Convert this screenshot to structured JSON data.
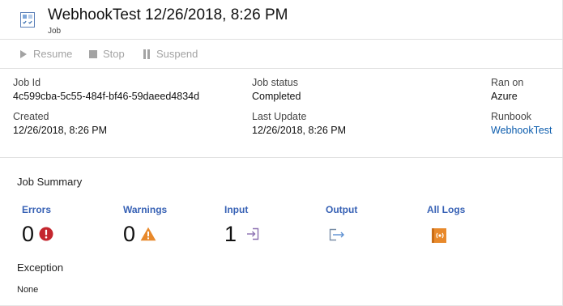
{
  "header": {
    "title": "WebhookTest 12/26/2018, 8:26 PM",
    "subtitle": "Job",
    "icon": "job-icon"
  },
  "toolbar": {
    "resume_label": "Resume",
    "stop_label": "Stop",
    "suspend_label": "Suspend",
    "disabled_color": "#a3a3a3"
  },
  "details": {
    "job_id_label": "Job Id",
    "job_id_value": "4c599cba-5c55-484f-bf46-59daeed4834d",
    "created_label": "Created",
    "created_value": "12/26/2018, 8:26 PM",
    "job_status_label": "Job status",
    "job_status_value": "Completed",
    "last_update_label": "Last Update",
    "last_update_value": "12/26/2018, 8:26 PM",
    "ran_on_label": "Ran on",
    "ran_on_value": "Azure",
    "runbook_label": "Runbook",
    "runbook_value": "WebhookTest"
  },
  "summary": {
    "title": "Job Summary",
    "errors_label": "Errors",
    "errors_count": "0",
    "warnings_label": "Warnings",
    "warnings_count": "0",
    "input_label": "Input",
    "input_count": "1",
    "output_label": "Output",
    "all_logs_label": "All Logs"
  },
  "exception": {
    "title": "Exception",
    "value": "None"
  },
  "colors": {
    "link": "#0b5cad",
    "tile_label": "#3862b5",
    "error": "#c4262e",
    "warning": "#e8892b",
    "logs": "#e8892b"
  }
}
